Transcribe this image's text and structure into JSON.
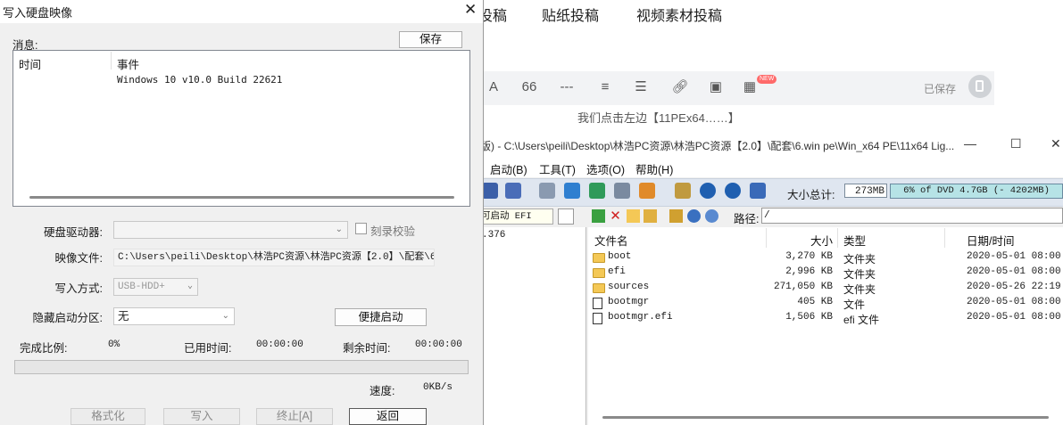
{
  "background_editor": {
    "nav_tabs": [
      "投稿",
      "贴纸投稿",
      "视频素材投稿"
    ],
    "saved_label": "已保存",
    "new_badge": "NEW",
    "editor_line": "我们点击左边【11PEx64……】",
    "toolbar_icons": [
      "font-color-icon",
      "quote-icon",
      "divider-icon",
      "align-icon",
      "list-icon",
      "link-icon",
      "image-icon",
      "widgets-icon"
    ]
  },
  "ultraiso": {
    "title": "版) - C:\\Users\\peili\\Desktop\\林浩PC资源\\林浩PC资源【2.0】\\配套\\6.win pe\\Win_x64 PE\\11x64 Lig...",
    "menu": [
      "启动(B)",
      "工具(T)",
      "选项(O)",
      "帮助(H)"
    ],
    "total_size_label": "大小总计:",
    "total_size_value": "273MB",
    "dvd_usage_text": "6% of DVD 4.7GB (- 4202MB)",
    "dvd_usage_fraction": 0.06,
    "efi_box": "可启动 EFI",
    "tree_value": ".376",
    "path_label": "路径:",
    "path_value": "/",
    "columns": {
      "name": "文件名",
      "size": "大小",
      "type": "类型",
      "date": "日期/时间"
    },
    "files": [
      {
        "name": "boot",
        "size": "3,270 KB",
        "type": "文件夹",
        "date": "2020-05-01 08:00",
        "icon": "folder"
      },
      {
        "name": "efi",
        "size": "2,996 KB",
        "type": "文件夹",
        "date": "2020-05-01 08:00",
        "icon": "folder"
      },
      {
        "name": "sources",
        "size": "271,050 KB",
        "type": "文件夹",
        "date": "2020-05-26 22:19",
        "icon": "folder"
      },
      {
        "name": "bootmgr",
        "size": "405 KB",
        "type": "文件",
        "date": "2020-05-01 08:00",
        "icon": "file"
      },
      {
        "name": "bootmgr.efi",
        "size": "1,506 KB",
        "type": "efi 文件",
        "date": "2020-05-01 08:00",
        "icon": "file"
      }
    ]
  },
  "dialog": {
    "title": "写入硬盘映像",
    "close_glyph": "✕",
    "message_label": "消息:",
    "save_button": "保存",
    "log_headers": {
      "time": "时间",
      "event": "事件"
    },
    "log_entries": [
      {
        "time": "",
        "event": "Windows 10 v10.0 Build 22621"
      }
    ],
    "drive_label": "硬盘驱动器:",
    "drive_value": "",
    "verify_label": "刻录校验",
    "verify_checked": false,
    "image_label": "映像文件:",
    "image_value": "C:\\Users\\peili\\Desktop\\林浩PC资源\\林浩PC资源【2.0】\\配套\\6.",
    "write_mode_label": "写入方式:",
    "write_mode_value": "USB-HDD+",
    "hidden_part_label": "隐藏启动分区:",
    "hidden_part_value": "无",
    "quick_boot_button": "便捷启动",
    "complete_label": "完成比例:",
    "complete_value": "0%",
    "progress_fraction": 0,
    "elapsed_label": "已用时间:",
    "elapsed_value": "00:00:00",
    "remaining_label": "剩余时间:",
    "remaining_value": "00:00:00",
    "speed_label": "速度:",
    "speed_value": "0KB/s",
    "buttons": {
      "format": "格式化",
      "write": "写入",
      "abort": "终止[A]",
      "back": "返回"
    }
  }
}
